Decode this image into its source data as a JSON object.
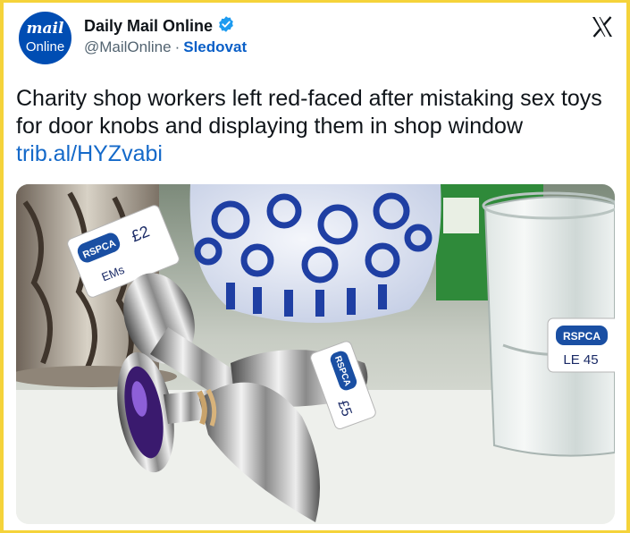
{
  "author": {
    "avatar_line1": "mail",
    "avatar_line2": "Online",
    "name": "Daily Mail Online",
    "handle": "@MailOnline",
    "separator": "·",
    "follow_label": "Sledovat"
  },
  "post": {
    "text": "Charity shop workers left red-faced after mistaking sex toys for door knobs and displaying them in shop window",
    "link": "trib.al/HYZvabi"
  },
  "media": {
    "tag_left_brand": "RSPCA",
    "tag_left_price": "£2",
    "tag_left_note": "EMs",
    "tag_right_brand": "RSPCA",
    "tag_right_note": "LE 45",
    "tag_mid_brand": "RSPCA",
    "tag_mid_price": "£5"
  },
  "colors": {
    "page_border": "#f5d33a",
    "avatar_bg": "#004db3",
    "verified": "#1d9bf0",
    "link": "#1469c9"
  },
  "icons": [
    "verified-badge-icon",
    "x-logo-icon"
  ]
}
